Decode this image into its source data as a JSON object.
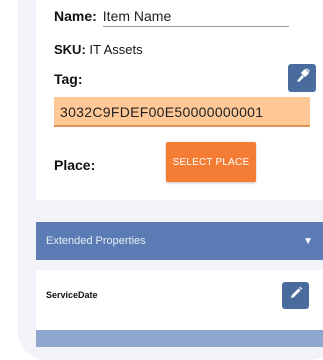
{
  "item": {
    "name_label": "Name:",
    "name_value": "Item Name",
    "sku_label": "SKU:",
    "sku_value": "IT Assets",
    "tag_label": "Tag:",
    "tag_value": "3032C9FDEF00E50000000001",
    "place_label": "Place:",
    "place_button": "SELECT PLACE"
  },
  "sections": {
    "extended_properties": "Extended Properties",
    "service_date_label": "ServiceDate"
  },
  "icons": {
    "tag_scan": "rfid-scanner-icon",
    "edit": "pencil-icon",
    "expand": "triangle-down-icon"
  },
  "colors": {
    "accent_blue": "#4a6b9d",
    "section_bar": "#5b7bb4",
    "tag_highlight": "#ffc896",
    "place_button": "#f47c34"
  }
}
